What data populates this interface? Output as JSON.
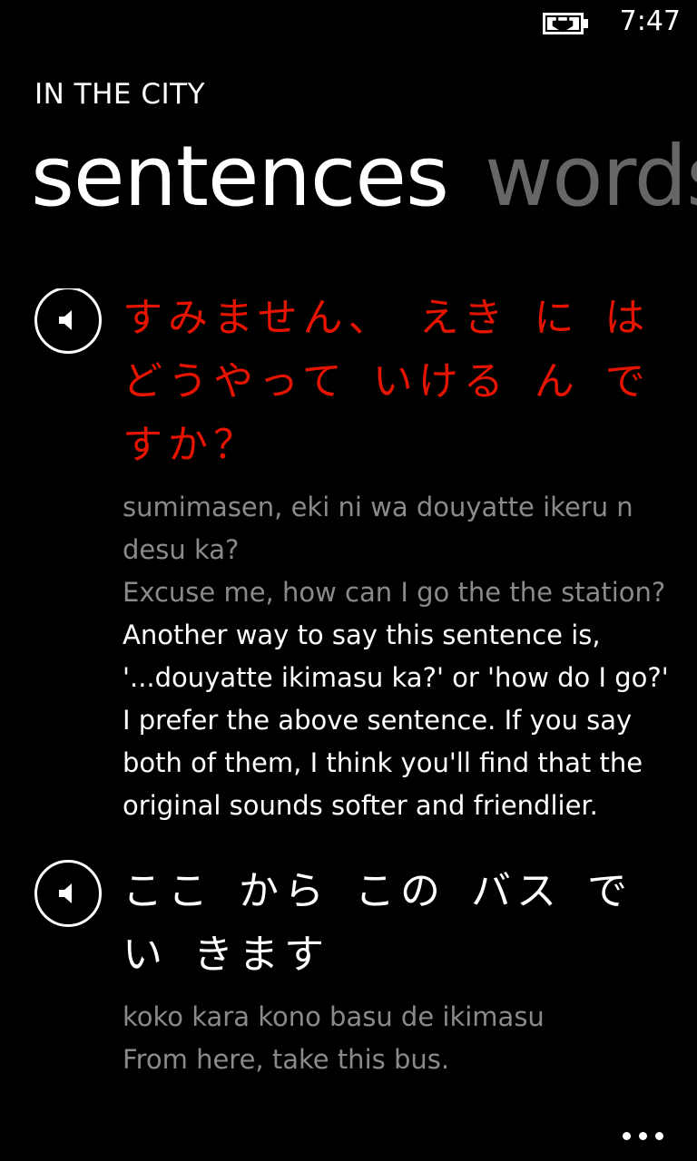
{
  "status": {
    "time": "7:47",
    "battery_icon": "battery-charging-icon"
  },
  "header": {
    "app_title": "IN THE CITY",
    "pivot": [
      {
        "label": "sentences",
        "active": true
      },
      {
        "label": "words",
        "active": false
      }
    ]
  },
  "entries": [
    {
      "speaker_icon": "speaker-icon",
      "japanese": "すみません、 えき に は どうやって いける ん ですか？",
      "romaji": "sumimasen, eki ni wa douyatte ikeru n desu ka?",
      "translation": "Excuse me, how can I go the the station?",
      "note": "Another way to say this sentence is, '...douyatte ikimasu ka?' or 'how do I go?' I prefer the above sentence. If you say both of them, I think you'll find that the original sounds softer and friendlier.",
      "highlight_color": "#e51400"
    },
    {
      "speaker_icon": "speaker-icon",
      "japanese": "ここ から この バス で い きます",
      "romaji": "koko kara kono basu de ikimasu",
      "translation": "From here, take this bus."
    }
  ],
  "app_bar": {
    "more_icon": "more-ellipsis-icon"
  }
}
